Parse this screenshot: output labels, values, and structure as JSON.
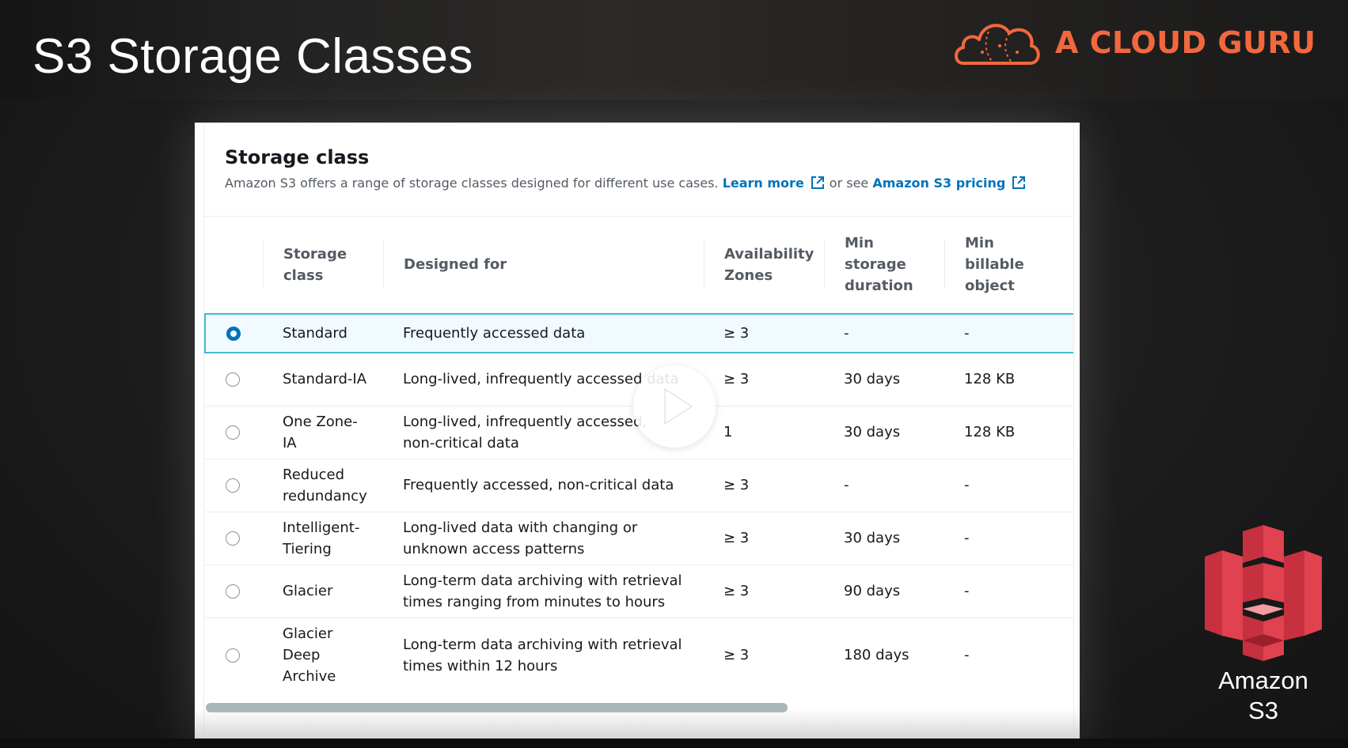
{
  "slide": {
    "title": "S3 Storage Classes",
    "brand": "A CLOUD GURU",
    "s3_label_line1": "Amazon",
    "s3_label_line2": "S3"
  },
  "card": {
    "title": "Storage class",
    "description": "Amazon S3 offers a range of storage classes designed for different use cases.",
    "learn_more": "Learn more",
    "or_see": "or see",
    "pricing_link": "Amazon S3 pricing"
  },
  "table": {
    "headers": {
      "storage_class": "Storage class",
      "designed_for": "Designed for",
      "availability_zones": "Availability Zones",
      "min_storage_duration": "Min storage duration",
      "min_billable_object": "Min billable object"
    },
    "rows": [
      {
        "storage_class": "Standard",
        "designed_for": "Frequently accessed data",
        "az": "≥ 3",
        "min_duration": "-",
        "min_billable": "-",
        "selected": true
      },
      {
        "storage_class": "Standard-IA",
        "designed_for": "Long-lived, infrequently accessed data",
        "az": "≥ 3",
        "min_duration": "30 days",
        "min_billable": "128 KB",
        "selected": false
      },
      {
        "storage_class": "One Zone-IA",
        "designed_for": "Long-lived, infrequently accessed, non-critical data",
        "az": "1",
        "min_duration": "30 days",
        "min_billable": "128 KB",
        "selected": false
      },
      {
        "storage_class": "Reduced redundancy",
        "designed_for": "Frequently accessed, non-critical data",
        "az": "≥ 3",
        "min_duration": "-",
        "min_billable": "-",
        "selected": false
      },
      {
        "storage_class": "Intelligent-Tiering",
        "designed_for": "Long-lived data with changing or unknown access patterns",
        "az": "≥ 3",
        "min_duration": "30 days",
        "min_billable": "-",
        "selected": false
      },
      {
        "storage_class": "Glacier",
        "designed_for": "Long-term data archiving with retrieval times ranging from minutes to hours",
        "az": "≥ 3",
        "min_duration": "90 days",
        "min_billable": "-",
        "selected": false
      },
      {
        "storage_class": "Glacier Deep Archive",
        "designed_for": "Long-term data archiving with retrieval times within 12 hours",
        "az": "≥ 3",
        "min_duration": "180 days",
        "min_billable": "-",
        "selected": false
      }
    ]
  },
  "colors": {
    "brand_orange": "#f2683d",
    "link_blue": "#0073bb",
    "selected_border": "#44b9d6",
    "s3_red": "#c7303f"
  },
  "icons": [
    "cloud-logo-icon",
    "external-link-icon",
    "play-icon",
    "amazon-s3-icon"
  ]
}
